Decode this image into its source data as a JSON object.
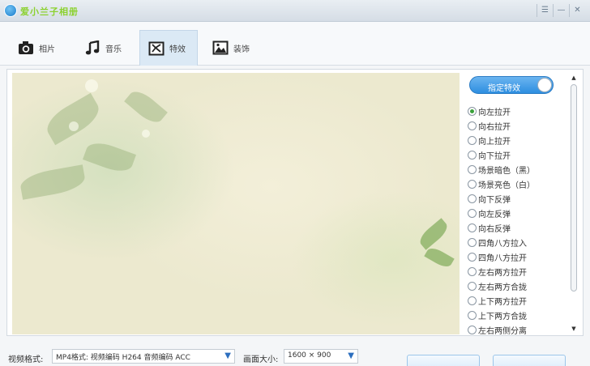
{
  "app": {
    "title": "爱小兰子相册"
  },
  "window": {
    "skin_icon": "☰",
    "minimize": "—",
    "close": "✕"
  },
  "tabs": [
    {
      "label": "相片",
      "icon": "camera-icon"
    },
    {
      "label": "音乐",
      "icon": "music-note-icon"
    },
    {
      "label": "特效",
      "icon": "effects-icon",
      "active": true
    },
    {
      "label": "装饰",
      "icon": "picture-icon"
    }
  ],
  "effects": {
    "toggle_label": "指定特效",
    "toggle_on": true,
    "selected": "向左拉开",
    "options": [
      "向左拉开",
      "向右拉开",
      "向上拉开",
      "向下拉开",
      "场景暗色（黑）",
      "场景亮色（白）",
      "向下反弹",
      "向左反弹",
      "向右反弹",
      "四角八方拉入",
      "四角八方拉开",
      "左右两方拉开",
      "左右两方合拢",
      "上下两方拉开",
      "上下两方合拢",
      "左右两侧分离"
    ]
  },
  "output": {
    "format_label": "视频格式:",
    "format_value": "MP4格式: 视频编码 H264 音频编码 ACC",
    "size_label": "画面大小:",
    "size_value": "1600 × 900"
  },
  "colors": {
    "accent": "#2d8ee0",
    "title_text": "#8bd12e",
    "radio_on": "#3aa03a"
  }
}
